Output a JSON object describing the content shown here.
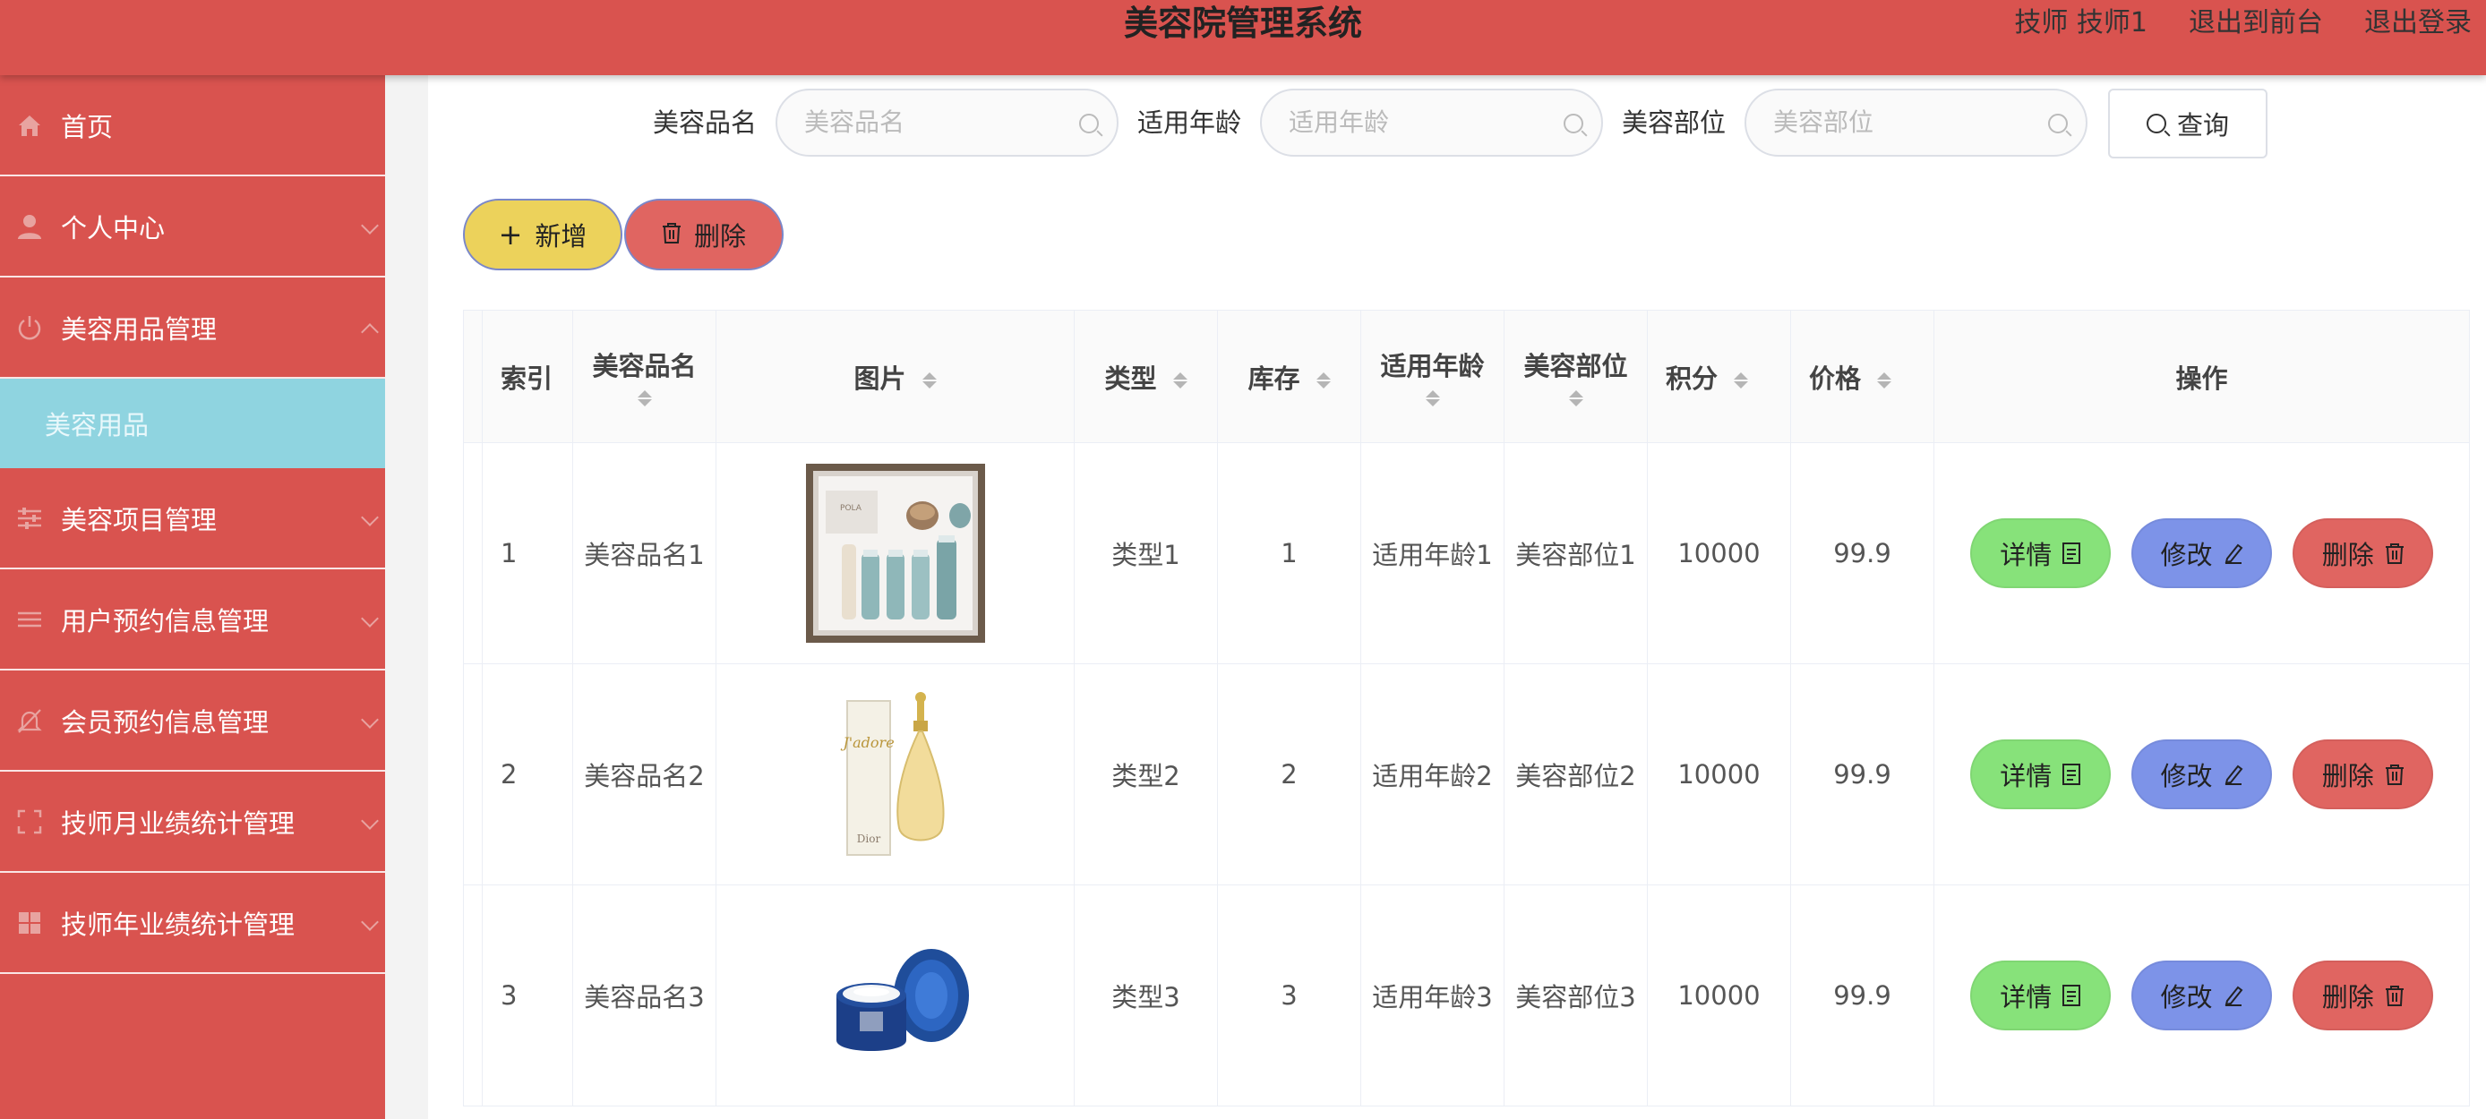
{
  "header": {
    "title": "美容院管理系统",
    "user": "技师 技师1",
    "to_front": "退出到前台",
    "logout": "退出登录"
  },
  "sidebar": {
    "items": [
      {
        "label": "首页",
        "icon": "home-icon"
      },
      {
        "label": "个人中心",
        "icon": "user-icon"
      },
      {
        "label": "美容用品管理",
        "icon": "power-icon",
        "expanded": true,
        "sub": [
          "美容用品"
        ]
      },
      {
        "label": "美容项目管理",
        "icon": "sliders-icon"
      },
      {
        "label": "用户预约信息管理",
        "icon": "list-icon"
      },
      {
        "label": "会员预约信息管理",
        "icon": "bell-off-icon"
      },
      {
        "label": "技师月业绩统计管理",
        "icon": "frame-icon"
      },
      {
        "label": "技师年业绩统计管理",
        "icon": "grid-icon"
      }
    ]
  },
  "search": {
    "name_label": "美容品名",
    "name_placeholder": "美容品名",
    "age_label": "适用年龄",
    "age_placeholder": "适用年龄",
    "part_label": "美容部位",
    "part_placeholder": "美容部位",
    "query_label": "查询"
  },
  "actions": {
    "add_label": "新增",
    "delete_label": "删除"
  },
  "table": {
    "columns": [
      "索引",
      "美容品名",
      "图片",
      "类型",
      "库存",
      "适用年龄",
      "美容部位",
      "积分",
      "价格",
      "操作"
    ],
    "rows": [
      {
        "index": "1",
        "name": "美容品名1",
        "type": "类型1",
        "stock": "1",
        "age": "适用年龄1",
        "part": "美容部位1",
        "points": "10000",
        "price": "99.9",
        "image": "skincare-set"
      },
      {
        "index": "2",
        "name": "美容品名2",
        "type": "类型2",
        "stock": "2",
        "age": "适用年龄2",
        "part": "美容部位2",
        "points": "10000",
        "price": "99.9",
        "image": "perfume-bottle"
      },
      {
        "index": "3",
        "name": "美容品名3",
        "type": "类型3",
        "stock": "3",
        "age": "适用年龄3",
        "part": "美容部位3",
        "points": "10000",
        "price": "99.9",
        "image": "cream-jar"
      }
    ],
    "row_actions": {
      "detail": "详情",
      "edit": "修改",
      "remove": "删除"
    }
  },
  "colors": {
    "primary_red": "#d9534f",
    "submenu_cyan": "#8fd4e0",
    "add_yellow": "#ecd25b",
    "detail_green": "#87e27a",
    "edit_blue": "#7d93e8",
    "delete_red": "#e06561"
  }
}
